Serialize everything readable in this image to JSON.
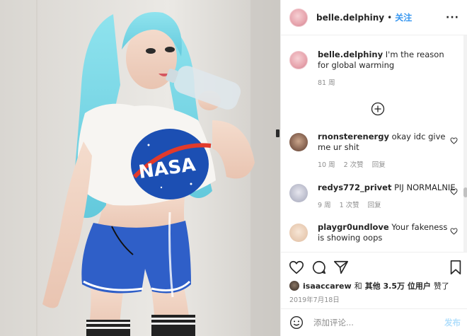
{
  "header": {
    "username": "belle.delphiny",
    "separator": "•",
    "follow_label": "关注",
    "more_label": "···"
  },
  "caption": {
    "username": "belle.delphiny",
    "text": "I'm the reason for global warming",
    "time": "81 周"
  },
  "comments": [
    {
      "username": "rnonsterenergy",
      "text": "okay idc give me ur shit",
      "time": "10 周",
      "likes": "2 次赞",
      "reply": "回复"
    },
    {
      "username": "redys772_privet",
      "text": "PIJ NORMALNIE",
      "time": "9 周",
      "likes": "1 次赞",
      "reply": "回复"
    },
    {
      "username": "playgr0undlove",
      "text": "Your fakeness is showing oops",
      "time": "",
      "likes": "",
      "reply": ""
    }
  ],
  "likes": {
    "user": "isaaccarew",
    "and": "和",
    "others": "其他 3.5万 位用户",
    "suffix": "赞了"
  },
  "date": "2019年7月18日",
  "add_comment": {
    "placeholder": "添加评论...",
    "post_label": "发布"
  },
  "photo_text": {
    "shirt_logo": "NASA"
  },
  "icons": {
    "more": "more-dots-icon",
    "load_more": "plus-circle-icon",
    "like": "heart-icon",
    "comment": "comment-bubble-icon",
    "share": "paper-plane-icon",
    "save": "bookmark-icon",
    "emoji": "smiley-icon"
  },
  "colors": {
    "follow": "#3897f0",
    "post_disabled": "#b2dffc",
    "meta": "#8e8e8e",
    "text": "#262626"
  }
}
